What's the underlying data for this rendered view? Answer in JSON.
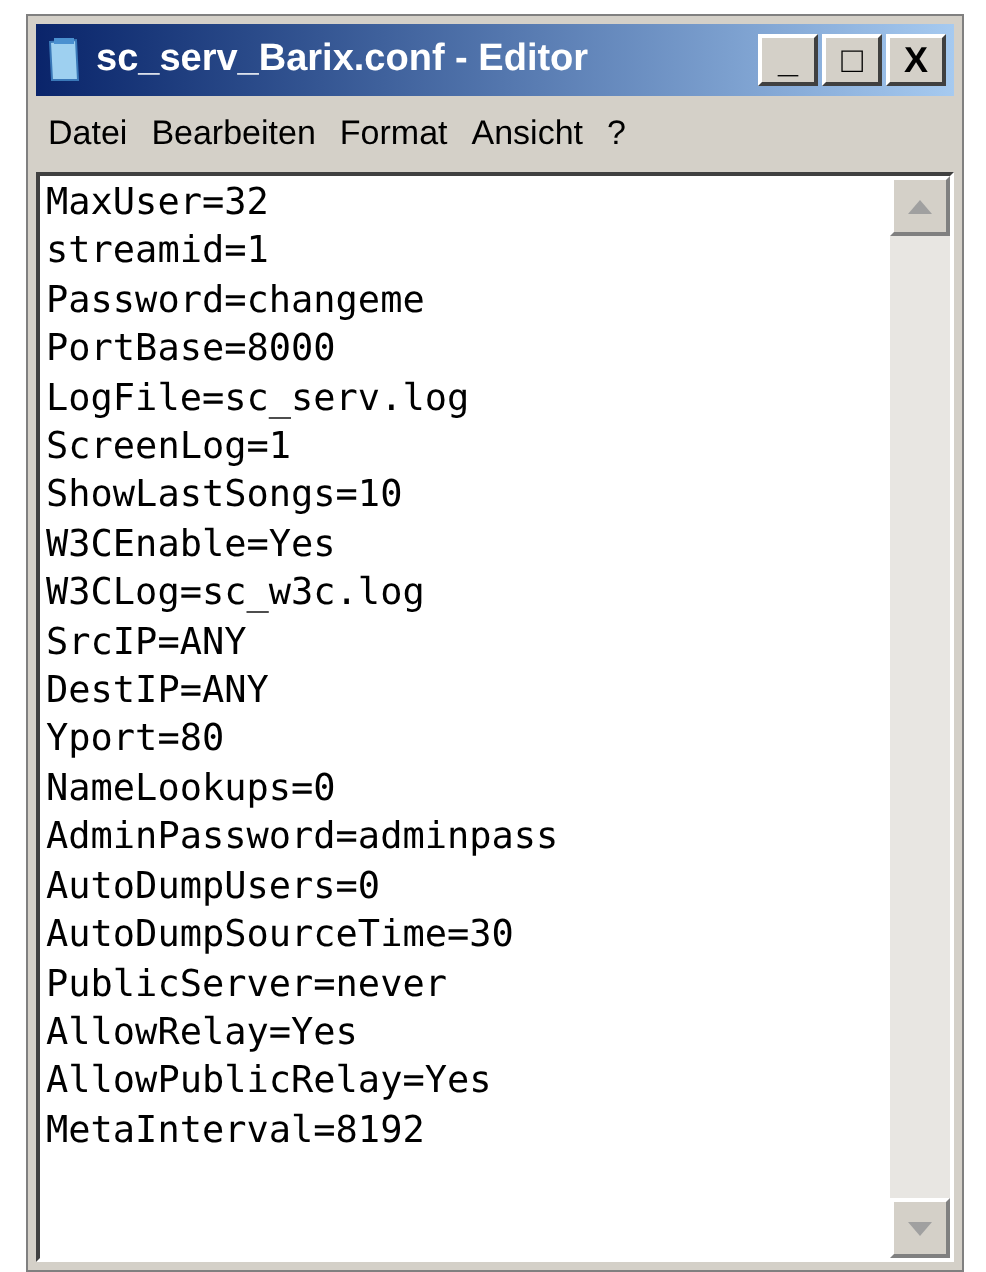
{
  "window": {
    "title": "sc_serv_Barix.conf - Editor",
    "controls": [
      "_",
      "□",
      "X"
    ]
  },
  "menu": [
    "Datei",
    "Bearbeiten",
    "Format",
    "Ansicht",
    "?"
  ],
  "lines": [
    "MaxUser=32",
    "streamid=1",
    "Password=changeme",
    "PortBase=8000",
    "LogFile=sc_serv.log",
    "ScreenLog=1",
    "ShowLastSongs=10",
    "W3CEnable=Yes",
    "W3CLog=sc_w3c.log",
    "SrcIP=ANY",
    "DestIP=ANY",
    "Yport=80",
    "NameLookups=0",
    "AdminPassword=adminpass",
    "AutoDumpUsers=0",
    "AutoDumpSourceTime=30",
    "PublicServer=never",
    "AllowRelay=Yes",
    "AllowPublicRelay=Yes",
    "MetaInterval=8192"
  ]
}
